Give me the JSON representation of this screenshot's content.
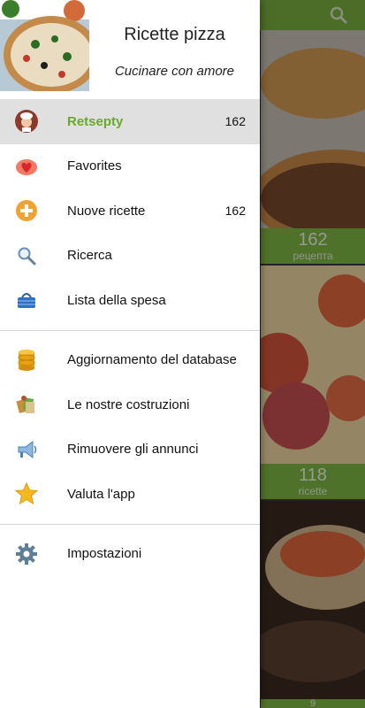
{
  "header": {
    "title": "Ricette pizza",
    "subtitle": "Cucinare con amore"
  },
  "menu_group_1": [
    {
      "label": "Retsepty",
      "badge": "162",
      "icon": "chef-icon",
      "active": true
    },
    {
      "label": "Favorites",
      "badge": "",
      "icon": "heart-icon"
    },
    {
      "label": "Nuove ricette",
      "badge": "162",
      "icon": "plus-circle-icon"
    },
    {
      "label": "Ricerca",
      "badge": "",
      "icon": "magnifier-icon"
    },
    {
      "label": "Lista della spesa",
      "badge": "",
      "icon": "shopping-basket-icon"
    }
  ],
  "menu_group_2": [
    {
      "label": "Aggiornamento del database",
      "icon": "database-icon"
    },
    {
      "label": "Le nostre costruzioni",
      "icon": "apps-icon"
    },
    {
      "label": "Rimuovere gli annunci",
      "icon": "megaphone-icon"
    },
    {
      "label": "Valuta l'app",
      "icon": "star-icon"
    }
  ],
  "menu_group_3": [
    {
      "label": "Impostazioni",
      "icon": "gear-icon"
    }
  ],
  "background": {
    "cards": [
      {
        "count": "162",
        "unit": "рецепта"
      },
      {
        "count": "118",
        "unit": "ricette"
      },
      {
        "count": "9",
        "unit": ""
      }
    ]
  },
  "colors": {
    "accent_green": "#6aaa2a",
    "toolbar_green": "#7bb13f",
    "active_row": "#e0e0e0"
  }
}
